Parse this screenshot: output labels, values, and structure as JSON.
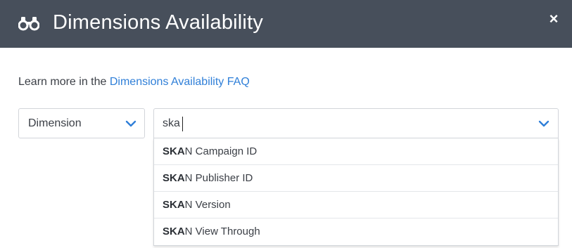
{
  "header": {
    "title": "Dimensions Availability",
    "icon": "binoculars-icon",
    "close_label": "×",
    "background": "#474f5b"
  },
  "faq": {
    "prefix": "Learn more in the ",
    "link_text": "Dimensions Availability FAQ",
    "link_color": "#2f7fd8"
  },
  "filter": {
    "type_select_value": "Dimension",
    "search_value": "ska"
  },
  "dropdown": {
    "options": [
      {
        "match": "SKA",
        "rest": "N Campaign ID"
      },
      {
        "match": "SKA",
        "rest": "N Publisher ID"
      },
      {
        "match": "SKA",
        "rest": "N Version"
      },
      {
        "match": "SKA",
        "rest": "N View Through"
      }
    ]
  }
}
